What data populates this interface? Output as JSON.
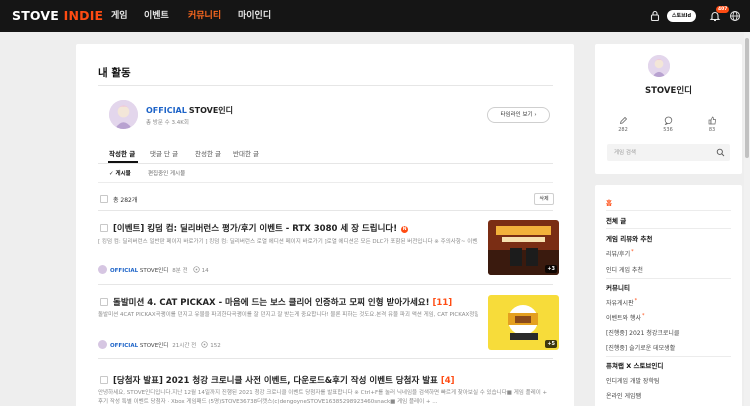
{
  "brand": {
    "logo_part1": "STOVE",
    "logo_part2": "INDIE",
    "accent": "#ff4b12"
  },
  "nav": {
    "items": [
      {
        "label": "게임"
      },
      {
        "label": "이벤트"
      },
      {
        "label": "커뮤니티",
        "active": true
      },
      {
        "label": "마이인디"
      }
    ],
    "account_label": "스토브Id",
    "notification_count": "407",
    "icons": [
      "lock-icon",
      "bell-icon",
      "globe-icon"
    ]
  },
  "page": {
    "title": "내 활동"
  },
  "profile": {
    "official_label": "OFFICIAL",
    "name": "STOVE인디",
    "followers": "총 방문 수 3.4K회",
    "timeline_button": "타임라인 보기",
    "timeline_icon": "chevron-right-icon"
  },
  "tabs": [
    {
      "label": "작성한 글",
      "active": true
    },
    {
      "label": "댓글 단 글"
    },
    {
      "label": "찬성한 글"
    },
    {
      "label": "반대한 글"
    }
  ],
  "subtabs": [
    {
      "label": "✓ 게시물",
      "active": true
    },
    {
      "label": "편집중인 게시물"
    }
  ],
  "list": {
    "total_label": "총 282개",
    "delete_label": "삭제"
  },
  "posts": [
    {
      "title": "[이벤트] 킹덤 컴: 딜리버런스 평가/후기 이벤트 - RTX 3080 세 장 드립니다!",
      "new_mark": "N",
      "excerpt": "[ 킹덤 컴: 딜리버런스 일반판 페이지 바로가기 ] 킹덤 컴: 딜리버런스 로열 에디션 페이지 바로가기 ]로열 에디션은 모든 DLC가 포함된 버전입니다 ※ 주의사항~ 이벤트 당첨자는 1월 6일(목) 오후 중 스토브 인디 커뮤니티를 통해 발표됩니다. - 스토브 게임 무료 쿠폰은 쿠폰 ...",
      "author_official": "OFFICIAL",
      "author": "STOVE인디",
      "time": "8분 전",
      "comments": "14",
      "image_count": "+3"
    },
    {
      "title": "돌발미션 4. CAT PICKAX - 마음에 드는 보스 클리어 인증하고 모찌 인형 받아가세요!",
      "count": "[11]",
      "excerpt": "돌발미션 4CAT PICKAX곡괭이를 던지고 유물을 파괴한다곡괭이를 잘 던지고 잘 받는게 중요합니다! 물론 피하는 것도요.본격 유물 파괴 액션 게임, CAT PICKAX정말재밌네요 마음에 드는 보스를 클리어한 인증샷을이 게시물에 댓글로 올려주세요!주최일을 통해 15분께 귀엽고 론 ...",
      "author_official": "OFFICIAL",
      "author": "STOVE인디",
      "time": "21시간 전",
      "comments": "152",
      "image_count": "+5"
    },
    {
      "title": "[당첨자 발표] 2021 청강 크로니클 사전 이벤트, 다운로드&후기 작성 이벤트 당첨자 발표",
      "count": "[4]",
      "excerpt": "안녕하세요, STOVE인디입니다.지난 12월 14일까지 진행된 2021 청강 크로니클 이벤트 당첨자를 발표합니다 ※ Ctrl+F를 눌러 닉네임을 검색하면 빠르게 찾아보실 수 있습니다■ 게임 플레이 + 후기 작성 특별 이벤트 당첨자 · Xbox 게임패드 (5명)STOVE36738더캣스(c)dengoyneSTOVE16385298923460snack■ 게임 플레이 + ..."
    }
  ],
  "sidebar": {
    "name": "STOVE인디",
    "stats": [
      {
        "icon": "pencil-icon",
        "value": "282"
      },
      {
        "icon": "comment-icon",
        "value": "536"
      },
      {
        "icon": "thumbs-up-icon",
        "value": "83"
      }
    ],
    "search_placeholder": "게임 검색",
    "nav": [
      {
        "label": "홈",
        "kind": "home"
      },
      {
        "label": "전체 글",
        "kind": "header"
      },
      {
        "label": "게임 리뷰와 추천",
        "kind": "header"
      },
      {
        "label": "리뷰/후기",
        "kind": "sub",
        "mark": "*"
      },
      {
        "label": "인디 게임 추천",
        "kind": "sub"
      },
      {
        "label": "커뮤니티",
        "kind": "header"
      },
      {
        "label": "자유게시판",
        "kind": "sub",
        "mark": "*"
      },
      {
        "label": "이벤트와 행사",
        "kind": "sub",
        "mark": "*"
      },
      {
        "label": "[진행중] 2021 청강크로니클",
        "kind": "sub"
      },
      {
        "label": "[진행중] 슬기로운 데모생활",
        "kind": "sub"
      },
      {
        "label": "퓨쳐랩 X 스토브인디",
        "kind": "header"
      },
      {
        "label": "인디게임 개발 장학팀",
        "kind": "sub"
      },
      {
        "label": "온라인 게임쨈",
        "kind": "sub"
      }
    ]
  }
}
